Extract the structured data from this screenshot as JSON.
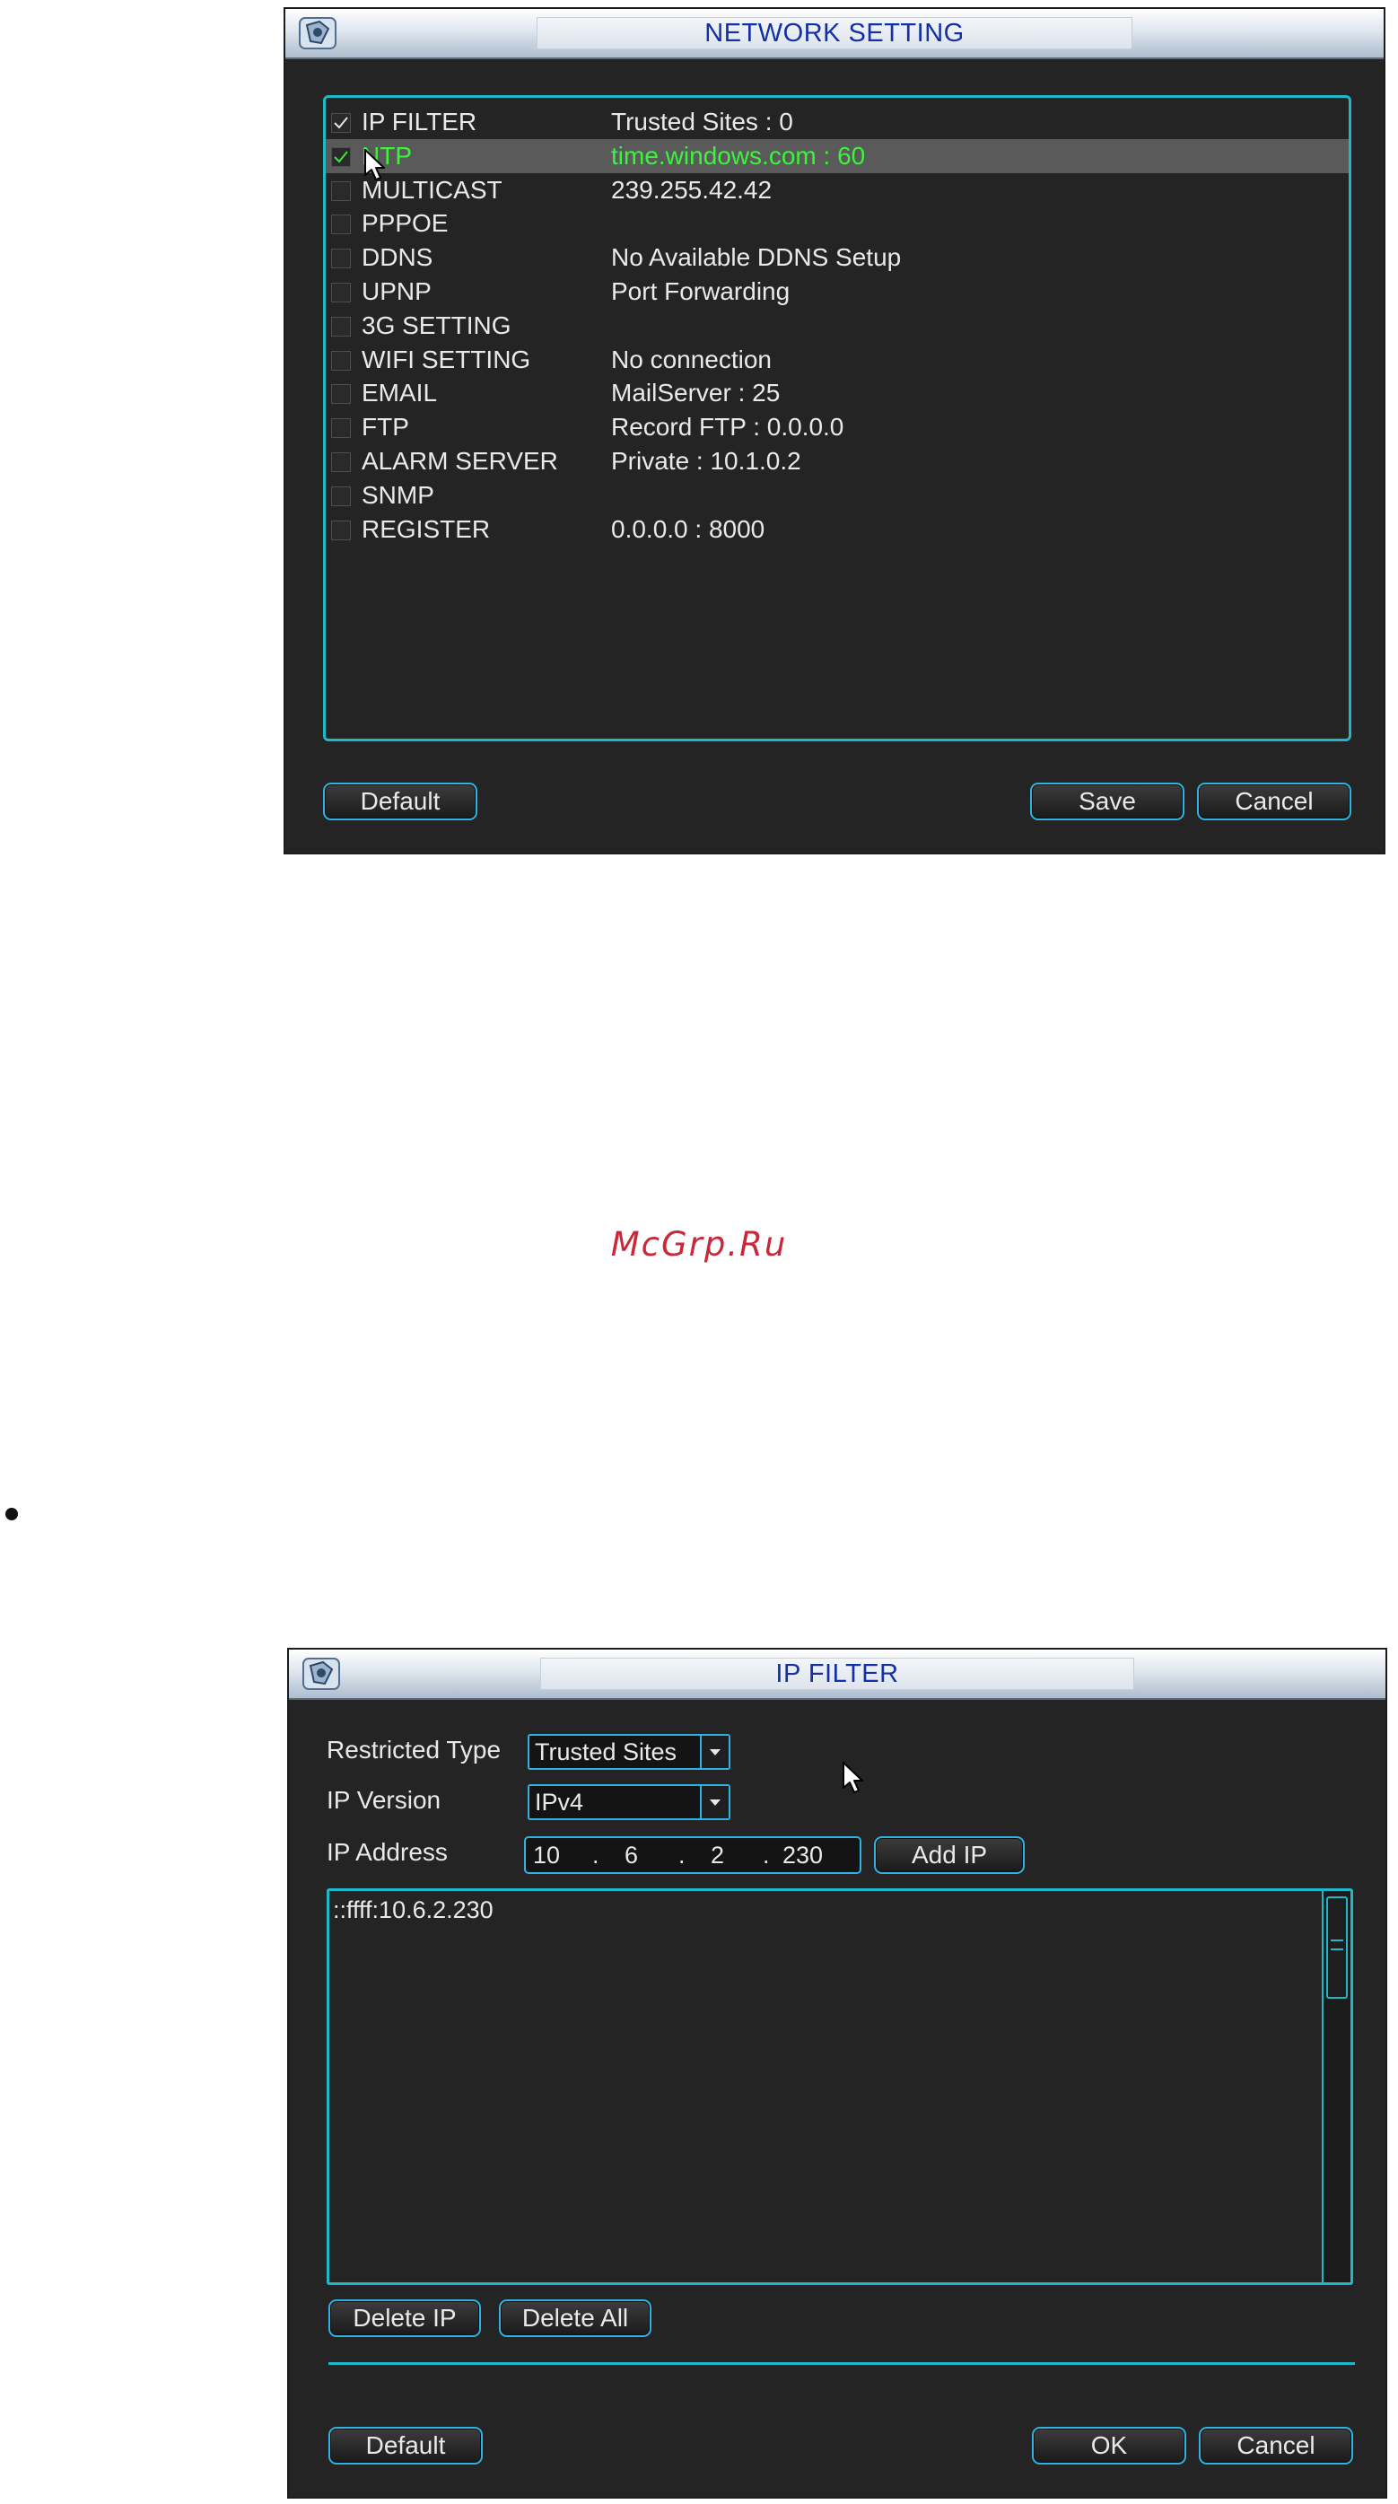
{
  "watermark": "McGrp.Ru",
  "network_setting": {
    "title": "NETWORK SETTING",
    "items": [
      {
        "label": "IP FILTER",
        "value": "Trusted Sites : 0",
        "checked": true,
        "highlighted": false
      },
      {
        "label": "NTP",
        "value": "time.windows.com : 60",
        "checked": true,
        "highlighted": true
      },
      {
        "label": "MULTICAST",
        "value": "239.255.42.42",
        "checked": false,
        "highlighted": false
      },
      {
        "label": "PPPOE",
        "value": "",
        "checked": false,
        "highlighted": false
      },
      {
        "label": "DDNS",
        "value": "No Available DDNS Setup",
        "checked": false,
        "highlighted": false
      },
      {
        "label": "UPNP",
        "value": "Port Forwarding",
        "checked": false,
        "highlighted": false
      },
      {
        "label": "3G SETTING",
        "value": "",
        "checked": false,
        "highlighted": false
      },
      {
        "label": "WIFI SETTING",
        "value": "No connection",
        "checked": false,
        "highlighted": false
      },
      {
        "label": "EMAIL",
        "value": "MailServer : 25",
        "checked": false,
        "highlighted": false
      },
      {
        "label": "FTP",
        "value": "Record FTP : 0.0.0.0",
        "checked": false,
        "highlighted": false
      },
      {
        "label": "ALARM SERVER",
        "value": "Private : 10.1.0.2",
        "checked": false,
        "highlighted": false
      },
      {
        "label": "SNMP",
        "value": "",
        "checked": false,
        "highlighted": false
      },
      {
        "label": "REGISTER",
        "value": "0.0.0.0 : 8000",
        "checked": false,
        "highlighted": false
      }
    ],
    "buttons": {
      "default": "Default",
      "save": "Save",
      "cancel": "Cancel"
    }
  },
  "ip_filter": {
    "title": "IP FILTER",
    "restricted_type": {
      "label": "Restricted Type",
      "value": "Trusted Sites"
    },
    "ip_version": {
      "label": "IP Version",
      "value": "IPv4"
    },
    "ip_address": {
      "label": "IP Address",
      "octets": [
        "10",
        "6",
        "2",
        "230"
      ],
      "separator": "."
    },
    "add_ip": "Add IP",
    "list": [
      "::ffff:10.6.2.230"
    ],
    "buttons": {
      "delete_ip": "Delete IP",
      "delete_all": "Delete All",
      "default": "Default",
      "ok": "OK",
      "cancel": "Cancel"
    }
  },
  "colors": {
    "accent": "#20b8c8",
    "highlight_text": "#3cf43c",
    "title_text": "#1330a6",
    "watermark": "#c8283a"
  }
}
